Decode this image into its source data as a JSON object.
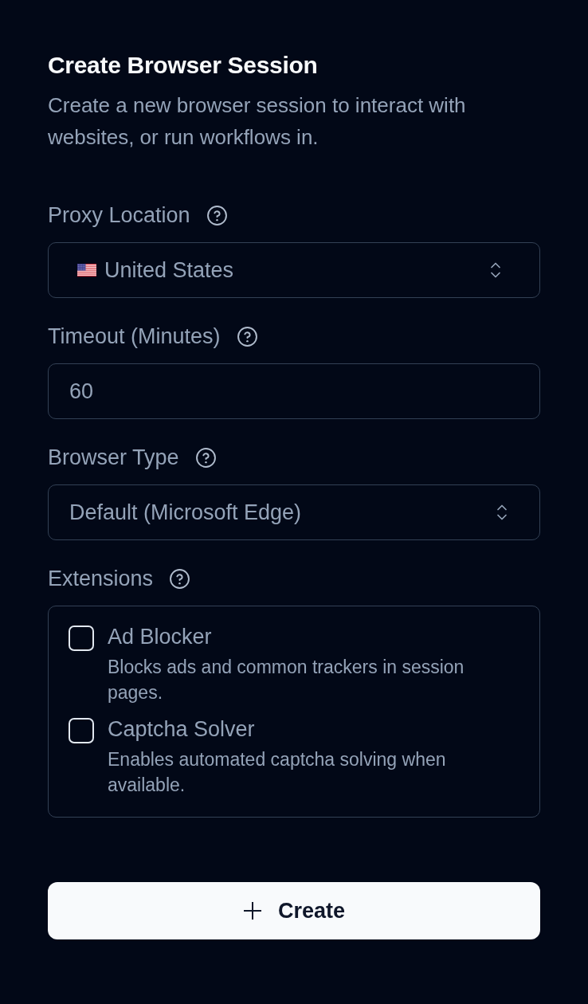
{
  "title": "Create Browser Session",
  "description": "Create a new browser session to interact with websites, or run workflows in.",
  "fields": [
    {
      "kind": "country_select",
      "label": "Proxy Location",
      "value": "United States"
    },
    {
      "kind": "number_input",
      "label": "Timeout (Minutes)",
      "value": "60"
    },
    {
      "kind": "select",
      "label": "Browser Type",
      "value": "Default (Microsoft Edge)"
    },
    {
      "kind": "checklist",
      "label": "Extensions",
      "options": [
        {
          "title": "Ad Blocker",
          "description": "Blocks ads and common trackers in session pages.",
          "checked": false
        },
        {
          "title": "Captcha Solver",
          "description": "Enables automated captcha solving when available.",
          "checked": false
        }
      ]
    }
  ],
  "create_button": {
    "label": "Create"
  }
}
